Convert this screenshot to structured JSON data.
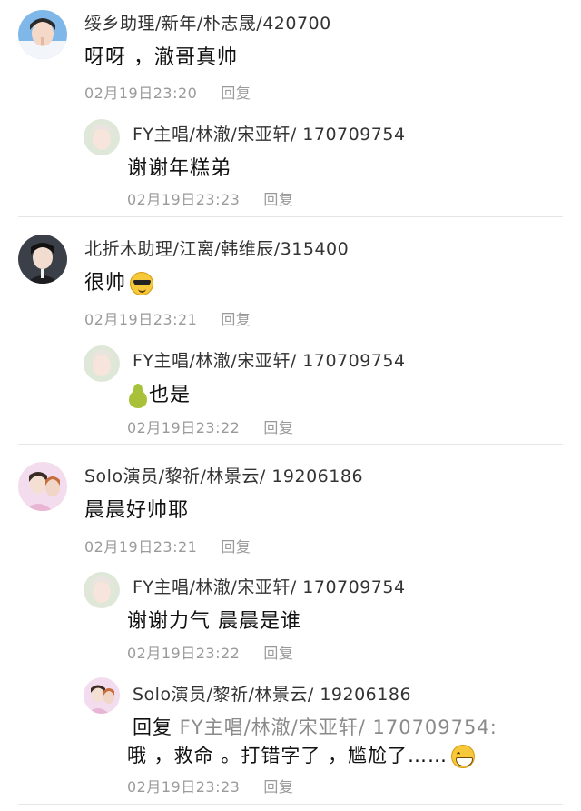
{
  "threads": [
    {
      "top": {
        "name": "绥乡助理/新年/朴志晟/420700",
        "text": "呀呀 ，澈哥真帅",
        "time": "02月19日23:20",
        "reply_label": "回复"
      },
      "replies": [
        {
          "name": "FY主唱/林澈/宋亚轩/ 170709754",
          "text": "谢谢年糕弟",
          "time": "02月19日23:23",
          "reply_label": "回复"
        }
      ]
    },
    {
      "top": {
        "name": "北折木助理/江离/韩维辰/315400",
        "text": "很帅",
        "emoji": "sunglasses-emoji",
        "time": "02月19日23:21",
        "reply_label": "回复"
      },
      "replies": [
        {
          "name": "FY主唱/林澈/宋亚轩/ 170709754",
          "emoji": "pear-emoji",
          "text": "也是",
          "time": "02月19日23:22",
          "reply_label": "回复"
        }
      ]
    },
    {
      "top": {
        "name": "Solo演员/黎祈/林景云/ 19206186",
        "text": "晨晨好帅耶",
        "time": "02月19日23:21",
        "reply_label": "回复"
      },
      "replies": [
        {
          "name": "FY主唱/林澈/宋亚轩/ 170709754",
          "text": "谢谢力气 晨晨是谁",
          "time": "02月19日23:22",
          "reply_label": "回复"
        },
        {
          "name": "Solo演员/黎祈/林景云/ 19206186",
          "reply_prefix": "回复",
          "mention": " FY主唱/林澈/宋亚轩/ 170709754:",
          "text": "哦 ，救命 。打错字了 ，尴尬了……",
          "emoji": "grin-emoji",
          "time": "02月19日23:23",
          "reply_label": "回复"
        }
      ]
    }
  ]
}
